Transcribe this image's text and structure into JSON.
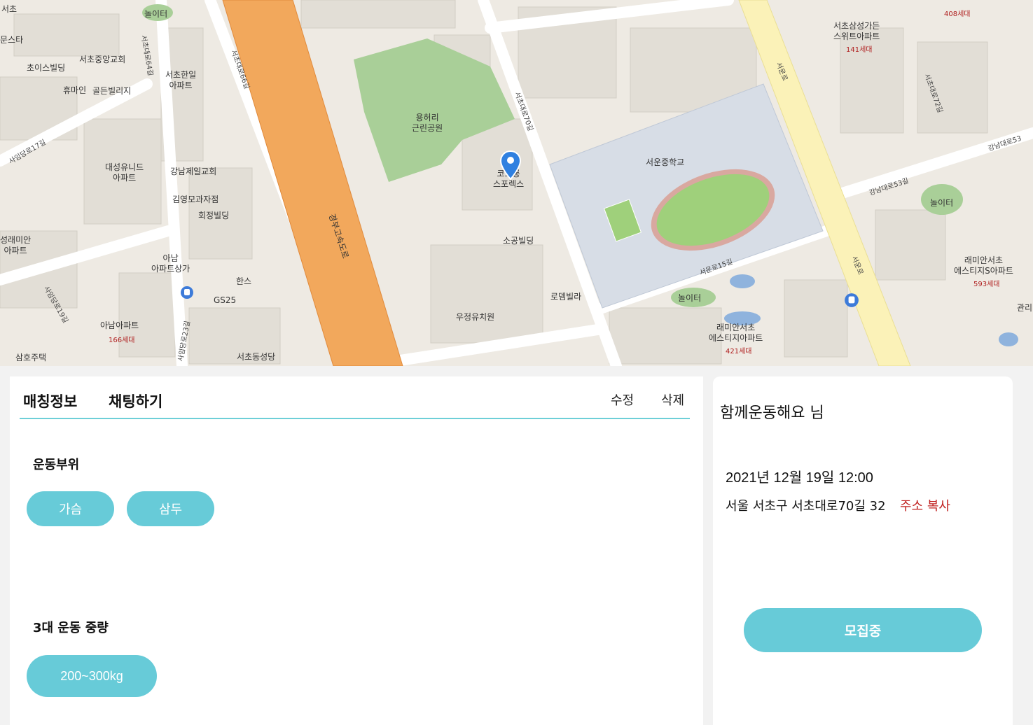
{
  "map": {
    "labels": {
      "seocho": "서초",
      "moonsta": "문스타",
      "playground1": "놀이터",
      "choice_bldg": "초이스빌딩",
      "seocho_central_church": "서초중앙교회",
      "seocho_hanil_apt": "서초한일\n아파트",
      "humane": "휴마인",
      "golden_villa": "골든빌리지",
      "daesung_apt": "대성유니드\n아파트",
      "gangnam_first_church": "강남제일교회",
      "kimyoungmo": "김영모과자점",
      "hoejung_bldg": "회정빌딩",
      "sungrae_apt": "성래미안\n아파트",
      "anam_mall": "아남\n아파트상가",
      "hans": "한스",
      "gs25": "GS25",
      "anam_apt": "아남아파트",
      "anam_households": "166세대",
      "samho": "삼호주택",
      "seocho_church": "서초동성당",
      "park": "용허리\n근린공원",
      "marker_place": "코오롱\n스포렉스",
      "sogong_bldg": "소공빌딩",
      "woojung": "우정유치원",
      "rodem": "로뎀빌라",
      "school": "서운중학교",
      "playground2": "놀이터",
      "playground3": "놀이터",
      "raemian_seocho": "래미안서초\n에스티지아파트",
      "raemian_households": "421세대",
      "samsung_suite": "서초삼성가든\n스위트아파트",
      "samsung_households": "141세대",
      "raemian_s": "래미안서초\n에스티지S아파트",
      "raemian_s_households": "593세대",
      "top_households": "408세대",
      "highway": "경부고속도로",
      "seoun_ro": "서운로",
      "seoun_ro_15": "서운로15길",
      "gangnam_53": "강남대로53길",
      "seocho_70": "서초대로70길",
      "seocho_72": "서초대로72길",
      "seocho_66": "서초대로66길",
      "seocho_64": "서초대로64길",
      "saimdang_17": "사임당로17길",
      "saimdang_19": "사임당로19길",
      "saimdang_23": "사임당로23길",
      "gangnam_53_top": "강남대로53",
      "kwan": "관리"
    }
  },
  "tabs": {
    "match_info": "매칭정보",
    "chat": "채팅하기"
  },
  "actions": {
    "edit": "수정",
    "delete": "삭제"
  },
  "sections": {
    "body_part": {
      "title": "운동부위",
      "chips": [
        "가슴",
        "삼두"
      ]
    },
    "weight": {
      "title": "3대 운동 중량",
      "chips": [
        "200~300kg"
      ]
    }
  },
  "info": {
    "title": "함께운동해요 님",
    "datetime": "2021년 12월 19일 12:00",
    "address": "서울 서초구 서초대로70길 32",
    "copy_address": "주소 복사",
    "status_button": "모집중"
  },
  "colors": {
    "accent": "#67cbd8",
    "accent_line": "#6ecfd8",
    "copy_red": "#c0201f",
    "map_marker": "#2f80e0"
  }
}
